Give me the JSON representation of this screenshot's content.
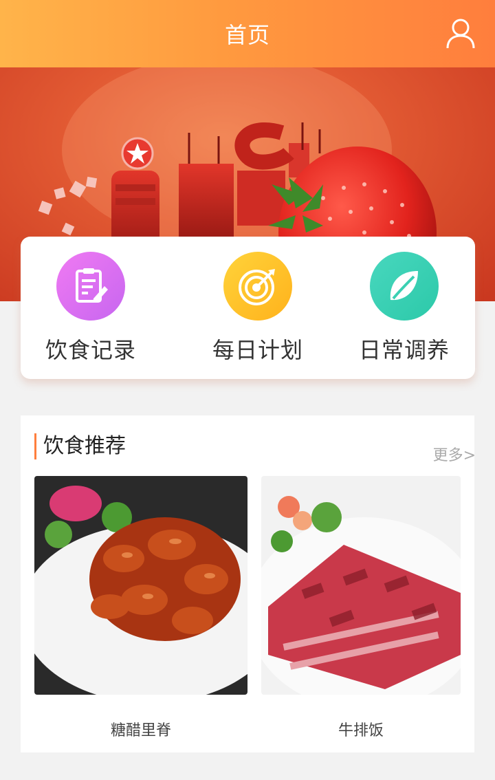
{
  "header": {
    "title": "首页",
    "user_icon": "user-icon"
  },
  "banner": {
    "description_icons": [
      "strawberry",
      "machine"
    ]
  },
  "menu": {
    "items": [
      {
        "label": "饮食记录",
        "icon": "clipboard-edit-icon",
        "color": "#d96ef1"
      },
      {
        "label": "每日计划",
        "icon": "target-icon",
        "color": "#ffc327"
      },
      {
        "label": "日常调养",
        "icon": "leaf-icon",
        "color": "#3bd0b3"
      }
    ]
  },
  "recommend": {
    "title": "饮食推荐",
    "more": "更多>",
    "foods": [
      {
        "name": "糖醋里脊"
      },
      {
        "name": "牛排饭"
      }
    ]
  },
  "colors": {
    "accent": "#ff7e3d",
    "header_start": "#ffb44a",
    "header_end": "#ff7e3d"
  }
}
